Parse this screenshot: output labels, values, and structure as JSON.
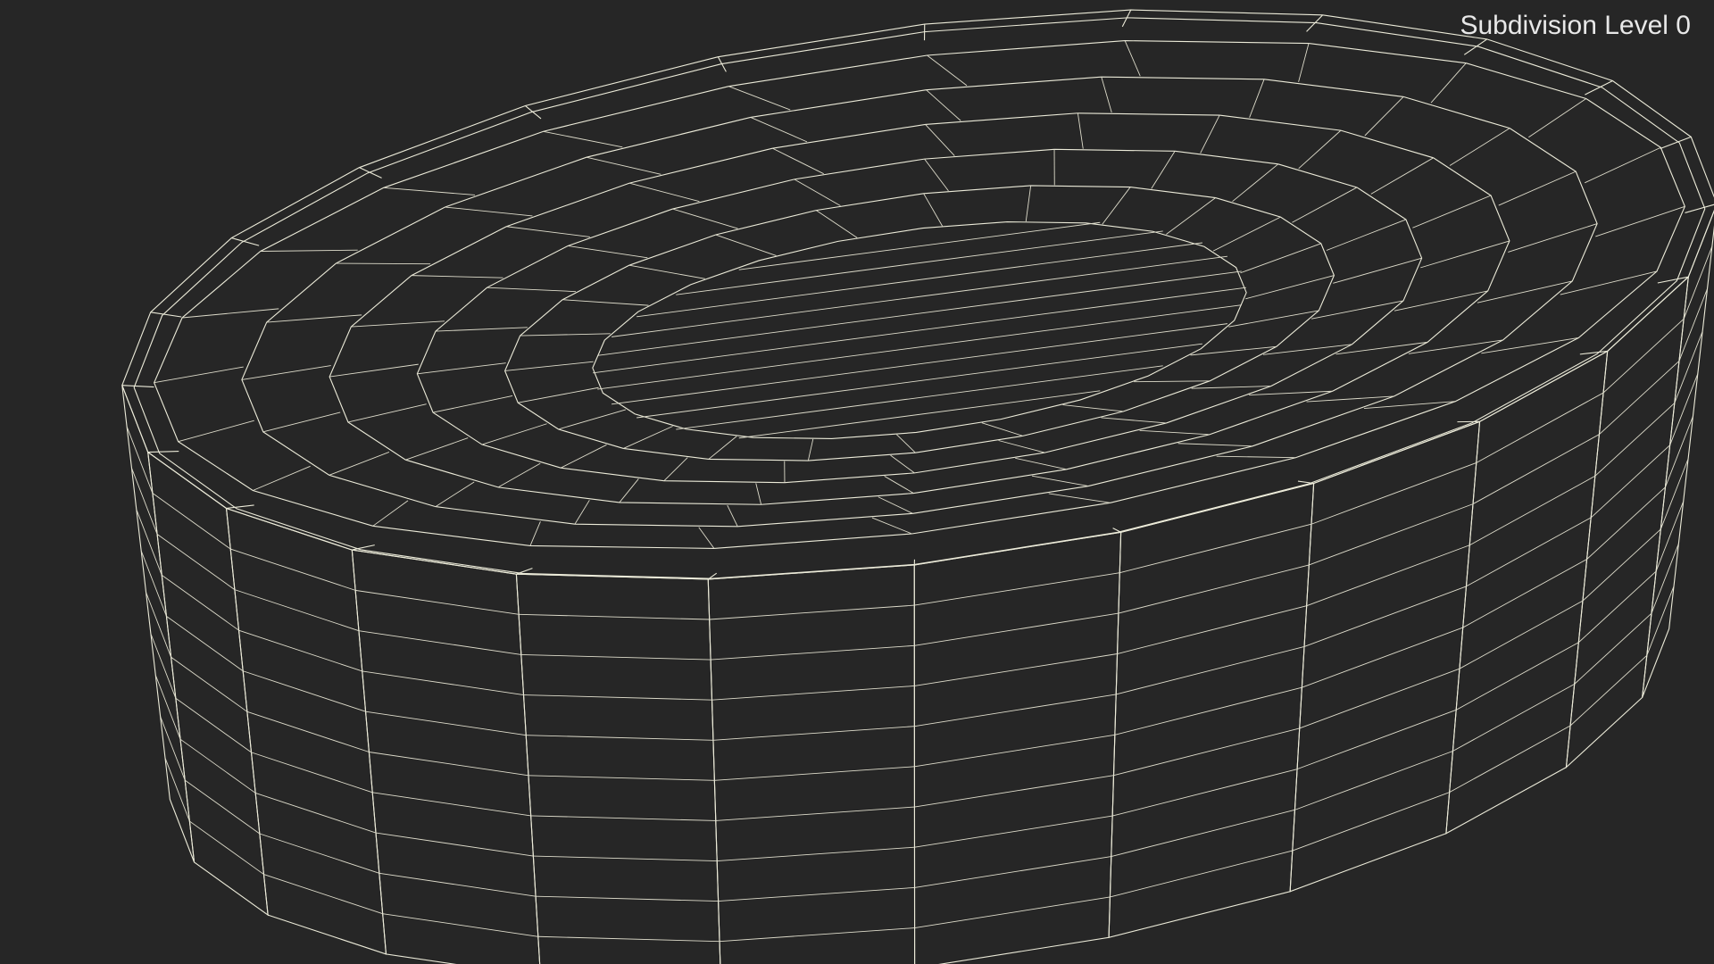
{
  "overlay": {
    "subdivision_label": "Subdivision Level 0"
  },
  "colors": {
    "background": "#262626",
    "surface": "#75756b",
    "surface_light": "#8a8a80",
    "surface_dark": "#64645b",
    "wire": "#ecebd9",
    "label": "#e8e8e8"
  },
  "model": {
    "description_icon": "wireframe-tray-icon",
    "inner_rings": 5,
    "segments": 24,
    "side_rows": 10
  }
}
